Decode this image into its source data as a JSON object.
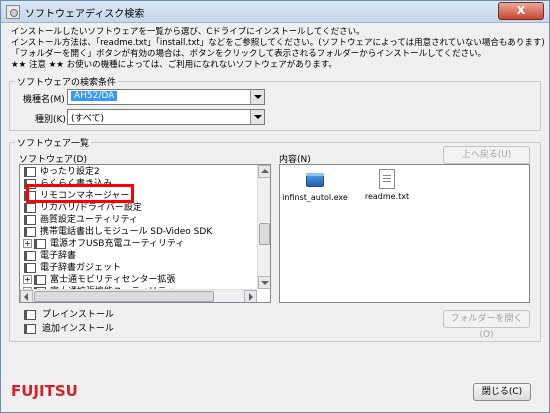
{
  "window": {
    "title": "ソフトウェアディスク検索",
    "close_label": "X"
  },
  "description": [
    "インストールしたいソフトウェアを一覧から選び、Cドライブにインストールしてください。",
    "インストール方法は、「readme.txt」「install.txt」などをご参照してください。(ソフトウェアによっては用意されていない場合もあります)",
    "「フォルダーを開く」ボタンが有効の場合は、ボタンをクリックして表示されるフォルダーからインストールしてください。",
    "★★ 注意 ★★ お使いの機種によっては、ご利用になれないソフトウェアがあります。"
  ],
  "search_conditions": {
    "group_label": "ソフトウェアの検索条件",
    "model_label": "機種名(M)",
    "model_value": "AH52/DA",
    "category_label": "種別(K)",
    "category_value": "(すべて)"
  },
  "software_list": {
    "group_label": "ソフトウェア一覧",
    "tree_label": "ソフトウェア(D)",
    "content_label": "内容(N)",
    "up_button": "上へ戻る(U)",
    "items": [
      {
        "label": "ゆったり設定2",
        "expander": ""
      },
      {
        "label": "らくらく書き込み",
        "expander": ""
      },
      {
        "label": "リモコンマネージャー",
        "expander": ""
      },
      {
        "label": "リカバリ/ドライバー設定",
        "expander": ""
      },
      {
        "label": "画質設定ユーティリティ",
        "expander": ""
      },
      {
        "label": "携帯電話書出しモジュール SD-Video SDK",
        "expander": ""
      },
      {
        "label": "電源オフUSB充電ユーティリティ",
        "expander": "+"
      },
      {
        "label": "電子辞書",
        "expander": ""
      },
      {
        "label": "電子辞書ガジェット",
        "expander": ""
      },
      {
        "label": "富士通モビリティセンター拡張",
        "expander": "+"
      },
      {
        "label": "富士通拡張機能ユーティリティ",
        "expander": "+"
      }
    ],
    "files": [
      {
        "name": "infinst_autol.exe",
        "icon": "exe-icon"
      },
      {
        "name": "readme.txt",
        "icon": "text-file-icon"
      }
    ],
    "actions": [
      {
        "label": "プレインストール",
        "icon": "book-icon"
      },
      {
        "label": "追加インストール",
        "icon": "book-icon"
      }
    ],
    "open_folder_button": "フォルダーを開く(O)"
  },
  "footer": {
    "brand": "FUJITSU",
    "close_button": "閉じる(C)"
  }
}
